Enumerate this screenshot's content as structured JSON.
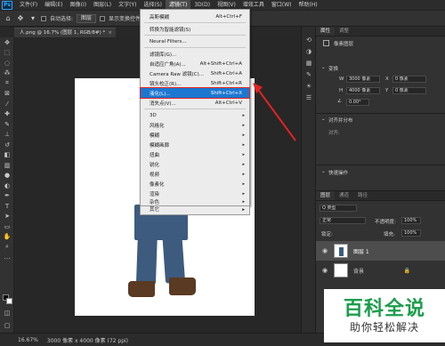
{
  "app": {
    "logo": "Ps"
  },
  "menubar": {
    "items": [
      "文件(F)",
      "编辑(E)",
      "图像(I)",
      "图层(L)",
      "文字(Y)",
      "选择(S)",
      "滤镜(T)",
      "3D(D)",
      "视图(V)",
      "增效工具",
      "窗口(W)",
      "帮助(H)"
    ],
    "active_index": 6
  },
  "optbar": {
    "auto_select_label": "自动选择:",
    "auto_select_value": "图层",
    "transform_label": "显示变换控件"
  },
  "doctab": {
    "title": "人.png @ 16.7% (图层 1, RGB/8#) *",
    "close": "×"
  },
  "filter_menu": {
    "items": [
      {
        "label": "高斯模糊",
        "shortcut": "Alt+Ctrl+F",
        "type": "item"
      },
      {
        "type": "sep"
      },
      {
        "label": "转换为智能滤镜(S)",
        "shortcut": "",
        "type": "item"
      },
      {
        "type": "sep"
      },
      {
        "label": "Neural Filters...",
        "shortcut": "",
        "type": "item"
      },
      {
        "type": "sep"
      },
      {
        "label": "滤镜库(G)...",
        "shortcut": "",
        "type": "item"
      },
      {
        "label": "自适应广角(A)...",
        "shortcut": "Alt+Shift+Ctrl+A",
        "type": "item"
      },
      {
        "label": "Camera Raw 滤镜(C)...",
        "shortcut": "Shift+Ctrl+A",
        "type": "item"
      },
      {
        "label": "镜头校正(R)...",
        "shortcut": "Shift+Ctrl+R",
        "type": "item"
      },
      {
        "label": "液化(L)...",
        "shortcut": "Shift+Ctrl+X",
        "type": "item",
        "highlight": true
      },
      {
        "label": "消失点(V)...",
        "shortcut": "Alt+Ctrl+V",
        "type": "item"
      },
      {
        "type": "sep"
      },
      {
        "label": "3D",
        "type": "sub"
      },
      {
        "label": "风格化",
        "type": "sub"
      },
      {
        "label": "模糊",
        "type": "sub"
      },
      {
        "label": "模糊画廊",
        "type": "sub"
      },
      {
        "label": "扭曲",
        "type": "sub"
      },
      {
        "label": "锐化",
        "type": "sub"
      },
      {
        "label": "视频",
        "type": "sub"
      },
      {
        "label": "像素化",
        "type": "sub"
      },
      {
        "label": "渲染",
        "type": "sub"
      },
      {
        "label": "杂色",
        "type": "sub"
      },
      {
        "label": "其它",
        "type": "sub"
      }
    ],
    "arrow": "▸"
  },
  "properties": {
    "tabs": [
      "属性",
      "调整"
    ],
    "kind": "像素图层",
    "transform_title": "变换",
    "w_label": "W",
    "w_value": "3000 像素",
    "h_label": "H",
    "h_value": "4000 像素",
    "x_label": "X",
    "x_value": "0 像素",
    "y_label": "Y",
    "y_value": "0 像素",
    "angle_value": "0.00°",
    "align_title": "对齐并分布",
    "align_sub": "对齐:",
    "quick_title": "快速操作"
  },
  "layers": {
    "tabs": [
      "图层",
      "通道",
      "路径"
    ],
    "filter_label": "Q 类型",
    "blend_mode": "正常",
    "opacity_label": "不透明度:",
    "opacity_value": "100%",
    "lock_label": "锁定:",
    "fill_label": "填充:",
    "fill_value": "100%",
    "rows": [
      {
        "name": "图层 1",
        "active": true
      },
      {
        "name": "背景",
        "active": false
      }
    ]
  },
  "status": {
    "zoom": "16.67%",
    "doc": "3000 像素 x 4000 像素 (72 ppi)"
  },
  "watermark": {
    "title": "百科全说",
    "subtitle": "助你轻松解决"
  },
  "colors": {
    "accent": "#1c77d1",
    "annotation": "#e32222",
    "jeans": "#3d5b7e",
    "boots": "#5a3a22"
  }
}
